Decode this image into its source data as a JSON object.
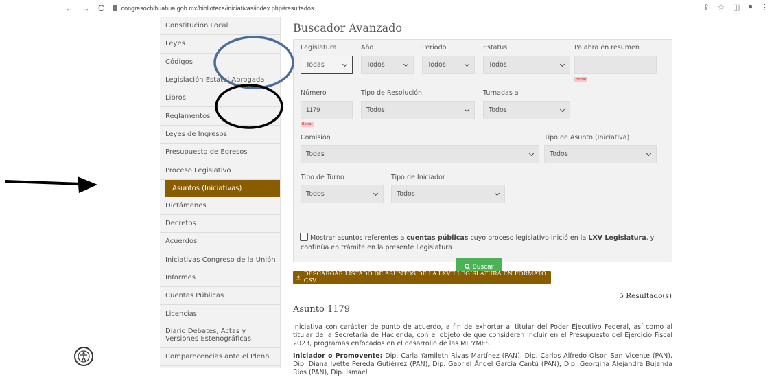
{
  "browser": {
    "url": "congresochihuahua.gob.mx/biblioteca/iniciativas/index.php#resultados"
  },
  "sidebar": {
    "items": [
      {
        "label": "Constitución Local"
      },
      {
        "label": "Leyes"
      },
      {
        "label": "Códigos"
      },
      {
        "label": "Legislación Estatal Abrogada"
      },
      {
        "label": "Libros"
      },
      {
        "label": "Reglamentos"
      },
      {
        "label": "Leyes de Ingresos"
      },
      {
        "label": "Presupuesto de Egresos"
      },
      {
        "label": "Proceso Legislativo"
      },
      {
        "label": "Asuntos (Iniciativas)",
        "active": true
      },
      {
        "label": "Dictámenes"
      },
      {
        "label": "Decretos"
      },
      {
        "label": "Acuerdos"
      },
      {
        "label": "Iniciativas Congreso de la Unión"
      },
      {
        "label": "Informes"
      },
      {
        "label": "Cuentas Públicas"
      },
      {
        "label": "Licencias"
      },
      {
        "label": "Diario Debates, Actas y Versiones Estenográficas"
      },
      {
        "label": "Comparecencias ante el Pleno"
      }
    ]
  },
  "search": {
    "title": "Buscador Avanzado",
    "legislatura_label": "Legislatura",
    "legislatura_value": "Todas",
    "anio_label": "Año",
    "anio_value": "Todos",
    "periodo_label": "Periodo",
    "periodo_value": "Todos",
    "estatus_label": "Estatus",
    "estatus_value": "Todos",
    "palabra_label": "Palabra en resumen",
    "palabra_value": "",
    "borrar": "Borrar",
    "numero_label": "Número",
    "numero_value": "1179",
    "tipo_resolucion_label": "Tipo de Resolución",
    "tipo_resolucion_value": "Todos",
    "turnadas_label": "Turnadas a",
    "turnadas_value": "Todos",
    "comision_label": "Comisión",
    "comision_value": "Todas",
    "tipo_asunto_label": "Tipo de Asunto (Iniciativa)",
    "tipo_asunto_value": "Todos",
    "tipo_turno_label": "Tipo de Turno",
    "tipo_turno_value": "Todos",
    "tipo_iniciador_label": "Tipo de Iniciador",
    "tipo_iniciador_value": "Todos",
    "checkbox_pre": "Mostrar asuntos referentes a ",
    "checkbox_bold1": "cuentas públicas",
    "checkbox_mid": " cuyo proceso legislativo inició en la ",
    "checkbox_bold2": "LXV Legislatura",
    "checkbox_post": ", y continúa en trámite en la presente Legislatura",
    "search_button": "Buscar"
  },
  "results": {
    "csv_button": "DESCARGAR LISTADO DE ASUNTOS DE LA LXVII LEGISLATURA EN FORMATO CSV",
    "count": "5 Resultado(s)",
    "asunto_title": "Asunto 1179",
    "description": "Iniciativa con carácter de punto de acuerdo, a fin de exhortar al titular del Poder Ejecutivo Federal, así como al titular de la Secretaría de Hacienda, con el objeto de que consideren incluir en el Presupuesto del Ejercicio Fiscal 2023, programas enfocados en el desarrollo de las MIPYMES.",
    "promovente_label": "Iniciador o Promovente:",
    "promovente": "Dip. Carla Yamileth Rivas Martínez (PAN), Dip. Carlos Alfredo Olson San Vicente (PAN), Dip. Diana Ivette Pereda Gutiérrez (PAN), Dip. Gabriel Ángel García Cantú (PAN), Dip. Georgina Alejandra Bujanda Ríos (PAN), Dip. Ismael"
  }
}
